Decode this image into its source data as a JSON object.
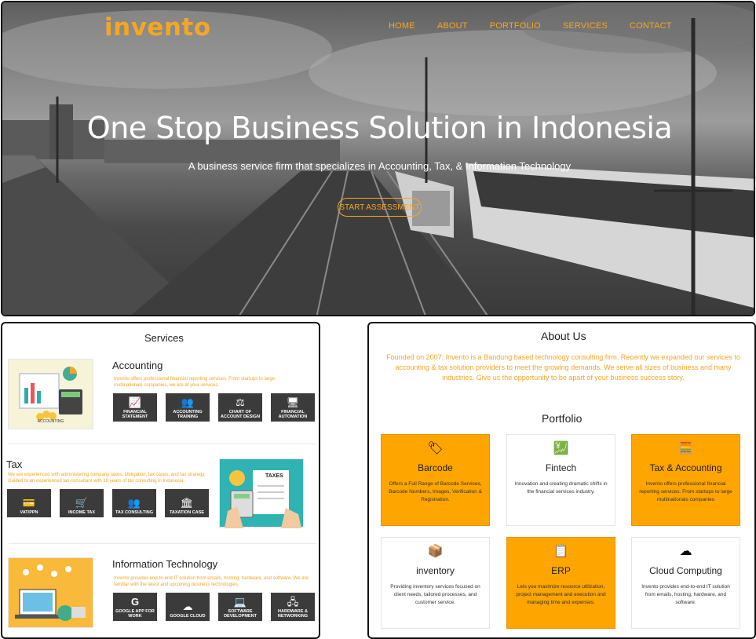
{
  "header": {
    "logo": "invento",
    "nav": [
      "HOME",
      "ABOUT",
      "PORTFOLIO",
      "SERVICES",
      "CONTACT"
    ]
  },
  "hero": {
    "title": "One Stop Business Solution in Indonesia",
    "subtitle": "A business service firm that specializes in Accounting, Tax, & Information Technology",
    "cta": "START ASSESSMENT"
  },
  "services": {
    "title": "Services",
    "accounting": {
      "heading": "Accounting",
      "image_caption": "ACCOUNTING",
      "desc": "Invento offers professional financial reporting services. From startups to large multinationals companies, we are at your services.",
      "tiles": [
        {
          "icon": "chart-icon",
          "label": "FINANCIAL STATEMENT"
        },
        {
          "icon": "people-icon",
          "label": "ACCOUNTING TRAINING"
        },
        {
          "icon": "scale-icon",
          "label": "CHART OF ACCOUNT DESIGN"
        },
        {
          "icon": "monitor-icon",
          "label": "FINANCIAL AUTOMATION"
        }
      ]
    },
    "tax": {
      "heading": "Tax",
      "image_caption": "TAXES",
      "desc": "We are experienced with administering company taxes: Obligation, tax cases, and tax strategy. Guided to an experienced tax consultant with 10 years of tax consulting in Indonesia.",
      "tiles": [
        {
          "icon": "card-icon",
          "label": "VAT/PPN"
        },
        {
          "icon": "cart-icon",
          "label": "INCOME TAX"
        },
        {
          "icon": "people-icon",
          "label": "TAX CONSULTING"
        },
        {
          "icon": "bank-icon",
          "label": "TAXATION CASE"
        }
      ]
    },
    "it": {
      "heading": "Information Technology",
      "desc": "Invento provides end-to-end IT solution from emails, hosting, hardware, and software. We are familiar with the latest and upcoming business technologies.",
      "tiles": [
        {
          "icon": "google-icon",
          "label": "GOOGLE APP FOR WORK"
        },
        {
          "icon": "cloud-icon",
          "label": "GOOGLE CLOUD"
        },
        {
          "icon": "laptop-icon",
          "label": "SOFTWARE DEVELOPMENT"
        },
        {
          "icon": "network-icon",
          "label": "HARDWARE & NETWORKING"
        }
      ]
    }
  },
  "about": {
    "title": "About Us",
    "text": "Founded on 2007, Invento is a Bandung based technology consulting firm. Recently we expanded our services to accounting & tax solution providers to meet the growing demands. We serve all sizes of business and many industries. Give us the opportunity to be apart of your business success story."
  },
  "portfolio": {
    "title": "Portfolio",
    "cards": [
      {
        "title": "Barcode",
        "desc": "Offers a Full Range of Barcode Services, Barcode Numbers, Images, Verification & Registration.",
        "style": "orange",
        "icon": "barcode-icon"
      },
      {
        "title": "Fintech",
        "desc": "Innovation and creating dramatic shifts in the financial services industry.",
        "style": "white",
        "icon": "fintech-icon"
      },
      {
        "title": "Tax & Accounting",
        "desc": "Invento offers professional financial reporting services. From startups to large multinationals companies",
        "style": "orange",
        "icon": "calculator-icon"
      },
      {
        "title": "inventory",
        "desc": "Providing inventory services focused on client needs, tailored processes, and customer service.",
        "style": "white",
        "icon": "inventory-icon"
      },
      {
        "title": "ERP",
        "desc": "Lets you maximize resource utilization, project management and execution and managing time and expenses.",
        "style": "orange",
        "icon": "clipboard-clock-icon"
      },
      {
        "title": "Cloud Computing",
        "desc": "Invento provides end-to-end IT solution from emails, hosting, hardware, and software.",
        "style": "white",
        "icon": "cloud-computing-icon"
      }
    ]
  },
  "colors": {
    "accent": "#f5a623",
    "card_orange": "#ffa500",
    "tile_dark": "#3b3b3b"
  }
}
